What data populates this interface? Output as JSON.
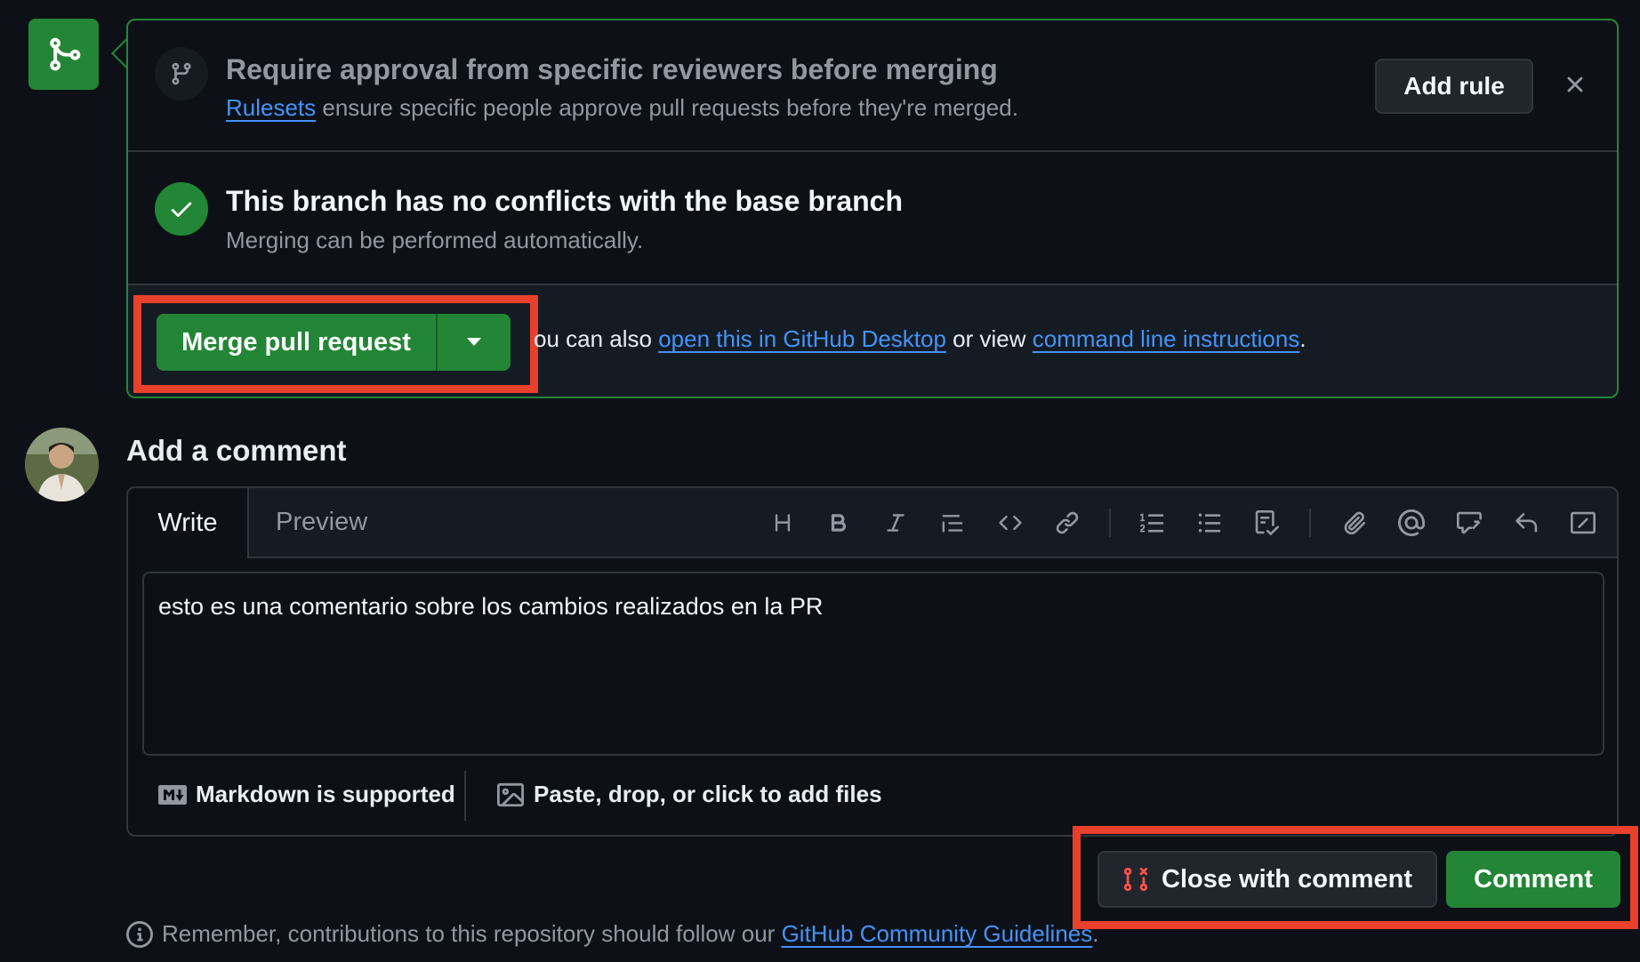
{
  "ruleset": {
    "title": "Require approval from specific reviewers before merging",
    "link": "Rulesets",
    "desc": " ensure specific people approve pull requests before they're merged.",
    "add_rule": "Add rule"
  },
  "status": {
    "title": "This branch has no conflicts with the base branch",
    "desc": "Merging can be performed automatically."
  },
  "merge": {
    "button": "Merge pull request",
    "alt_prefix": "ou can also ",
    "alt_link1": "open this in GitHub Desktop",
    "alt_mid": " or view ",
    "alt_link2": "command line instructions",
    "alt_suffix": "."
  },
  "comment": {
    "heading": "Add a comment",
    "tab_write": "Write",
    "tab_preview": "Preview",
    "toolbar_icons": [
      "heading-icon",
      "bold-icon",
      "italic-icon",
      "quote-icon",
      "code-icon",
      "link-icon",
      "ordered-list-icon",
      "unordered-list-icon",
      "task-list-icon",
      "attach-icon",
      "mention-icon",
      "reference-icon",
      "saved-reply-icon",
      "slash-command-icon"
    ],
    "text": "esto es una comentario sobre los cambios realizados en la PR",
    "markdown_note": "Markdown is supported",
    "files_note": "Paste, drop, or click to add files",
    "close_button": "Close with comment",
    "comment_button": "Comment"
  },
  "remember": {
    "prefix": "Remember, contributions to this repository should follow our ",
    "link": "GitHub Community Guidelines",
    "suffix": "."
  },
  "colors": {
    "background": "#0d1117",
    "green": "#238636",
    "link": "#4493f8",
    "highlight": "#e8402b",
    "close_icon": "#f85149"
  }
}
